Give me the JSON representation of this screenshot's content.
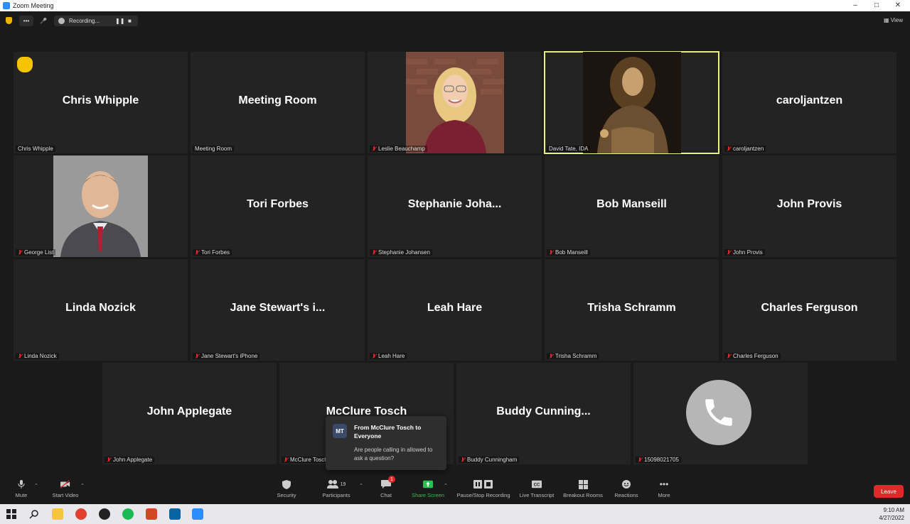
{
  "window": {
    "title": "Zoom Meeting"
  },
  "meeting_bar": {
    "recording_label": "Recording...",
    "view_label": "View"
  },
  "tiles": [
    {
      "name": "Chris Whipple",
      "label": "Chris Whipple"
    },
    {
      "name": "Meeting Room",
      "label": "Meeting Room"
    },
    {
      "name": "",
      "label": "Leslie Beauchamp"
    },
    {
      "name": "",
      "label": "David Tate, IDA"
    },
    {
      "name": "caroljantzen",
      "label": "caroljantzen"
    },
    {
      "name": "",
      "label": "George List"
    },
    {
      "name": "Tori Forbes",
      "label": "Tori Forbes"
    },
    {
      "name": "Stephanie  Joha...",
      "label": "Stephanie Johansen"
    },
    {
      "name": "Bob Manseill",
      "label": "Bob Manseill"
    },
    {
      "name": "John Provis",
      "label": "John Provis"
    },
    {
      "name": "Linda Nozick",
      "label": "Linda Nozick"
    },
    {
      "name": "Jane Stewart's i...",
      "label": "Jane Stewart's iPhone"
    },
    {
      "name": "Leah Hare",
      "label": "Leah Hare"
    },
    {
      "name": "Trisha Schramm",
      "label": "Trisha Schramm"
    },
    {
      "name": "Charles Ferguson",
      "label": "Charles Ferguson"
    },
    {
      "name": "John Applegate",
      "label": "John Applegate"
    },
    {
      "name": "McClure Tosch",
      "label": "McClure Tosch"
    },
    {
      "name": "Buddy  Cunning...",
      "label": "Buddy Cunningham"
    },
    {
      "name": "",
      "label": "15098021705"
    }
  ],
  "chat_popup": {
    "avatar_initials": "MT",
    "from": "From McClure Tosch to Everyone",
    "message": "Are people calling in allowed to ask a question?"
  },
  "toolbar": {
    "mute": "Mute",
    "start_video": "Start Video",
    "security": "Security",
    "participants": "Participants",
    "participants_count": "19",
    "chat": "Chat",
    "chat_badge": "1",
    "share_screen": "Share Screen",
    "pause_stop_recording": "Pause/Stop Recording",
    "live_transcript": "Live Transcript",
    "breakout_rooms": "Breakout Rooms",
    "reactions": "Reactions",
    "more": "More",
    "leave": "Leave"
  },
  "taskbar": {
    "time": "9:10 AM",
    "date": "4/27/2022"
  },
  "colors": {
    "active_speaker_border": "#e8f08a",
    "leave_red": "#e02828",
    "share_green": "#23c552"
  }
}
